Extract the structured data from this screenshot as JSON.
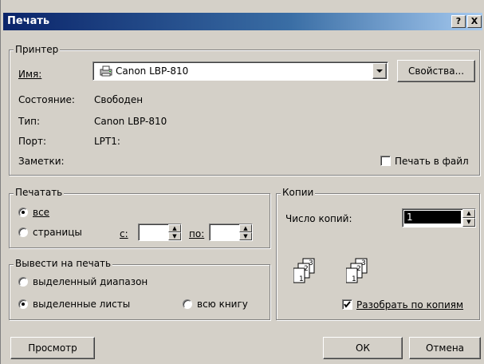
{
  "window": {
    "title": "Печать",
    "help_label": "?",
    "close_label": "X"
  },
  "printer": {
    "legend": "Принтер",
    "name_label": "Имя:",
    "name_value": "Canon LBP-810",
    "properties_button": "Свойства...",
    "status_label": "Состояние:",
    "status_value": "Свободен",
    "type_label": "Тип:",
    "type_value": "Canon LBP-810",
    "port_label": "Порт:",
    "port_value": "LPT1:",
    "comment_label": "Заметки:",
    "print_to_file_label": "Печать в файл",
    "print_to_file_checked": false
  },
  "print_range": {
    "legend": "Печатать",
    "all_label": "все",
    "pages_label": "страницы",
    "from_label": "с:",
    "to_label": "по:",
    "from_value": "",
    "to_value": "",
    "selected": "all"
  },
  "print_what": {
    "legend": "Вывести на печать",
    "selection_label": "выделенный диапазон",
    "sheets_label": "выделенные листы",
    "workbook_label": "всю книгу",
    "selected": "sheets"
  },
  "copies": {
    "legend": "Копии",
    "count_label": "Число копий:",
    "count_value": "1",
    "collate_label": "Разобрать по копиям",
    "collate_checked": true
  },
  "footer": {
    "preview_button": "Просмотр",
    "ok_button": "ОК",
    "cancel_button": "Отмена"
  },
  "colors": {
    "face": "#d4d0c8",
    "title_start": "#0a246a",
    "title_end": "#a6caf0",
    "highlight": "#000000"
  }
}
